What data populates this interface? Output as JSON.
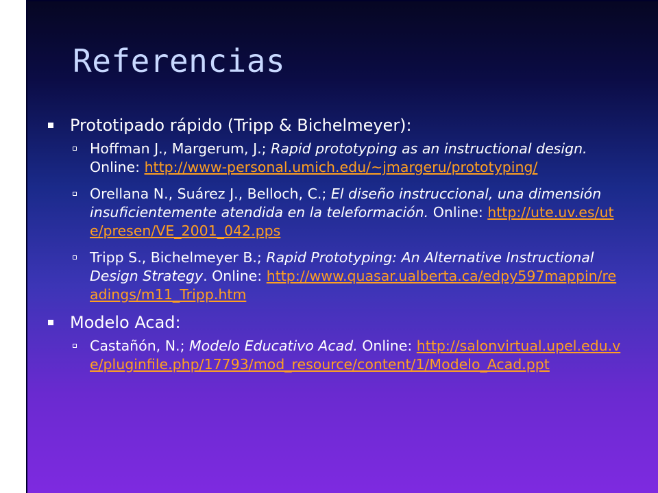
{
  "slide": {
    "title": "Referencias",
    "sections": [
      {
        "heading": "Prototipado rápido (Tripp & Bichelmeyer):",
        "refs": [
          {
            "authors": "Hoffman J., Margerum, J.; ",
            "work": "Rapid prototyping as an instructional design.",
            "online": " Online: ",
            "url": "http://www-personal.umich.edu/~jmargeru/prototyping/"
          },
          {
            "authors": "Orellana N., Suárez J., Belloch, C.; ",
            "work": "El diseño instruccional, una dimensión insuficientemente atendida en la teleformación.",
            "online": " Online: ",
            "url": "http://ute.uv.es/ute/presen/VE_2001_042.pps"
          },
          {
            "authors": "Tripp S., Bichelmeyer B.; ",
            "work": "Rapid Prototyping: An Alternative Instructional Design Strategy",
            "online": ". Online: ",
            "url": "http://www.quasar.ualberta.ca/edpy597mappin/readings/m11_Tripp.htm"
          }
        ]
      },
      {
        "heading": "Modelo Acad:",
        "refs": [
          {
            "authors": "Castañón, N.; ",
            "work": "Modelo Educativo Acad.",
            "online": " Online: ",
            "url": "http://salonvirtual.upel.edu.ve/pluginfile.php/17793/mod_resource/content/1/Modelo_Acad.ppt"
          }
        ]
      }
    ]
  },
  "colors": {
    "link": "#ffa020",
    "title": "#c8d8ff",
    "text": "#ffffff"
  }
}
